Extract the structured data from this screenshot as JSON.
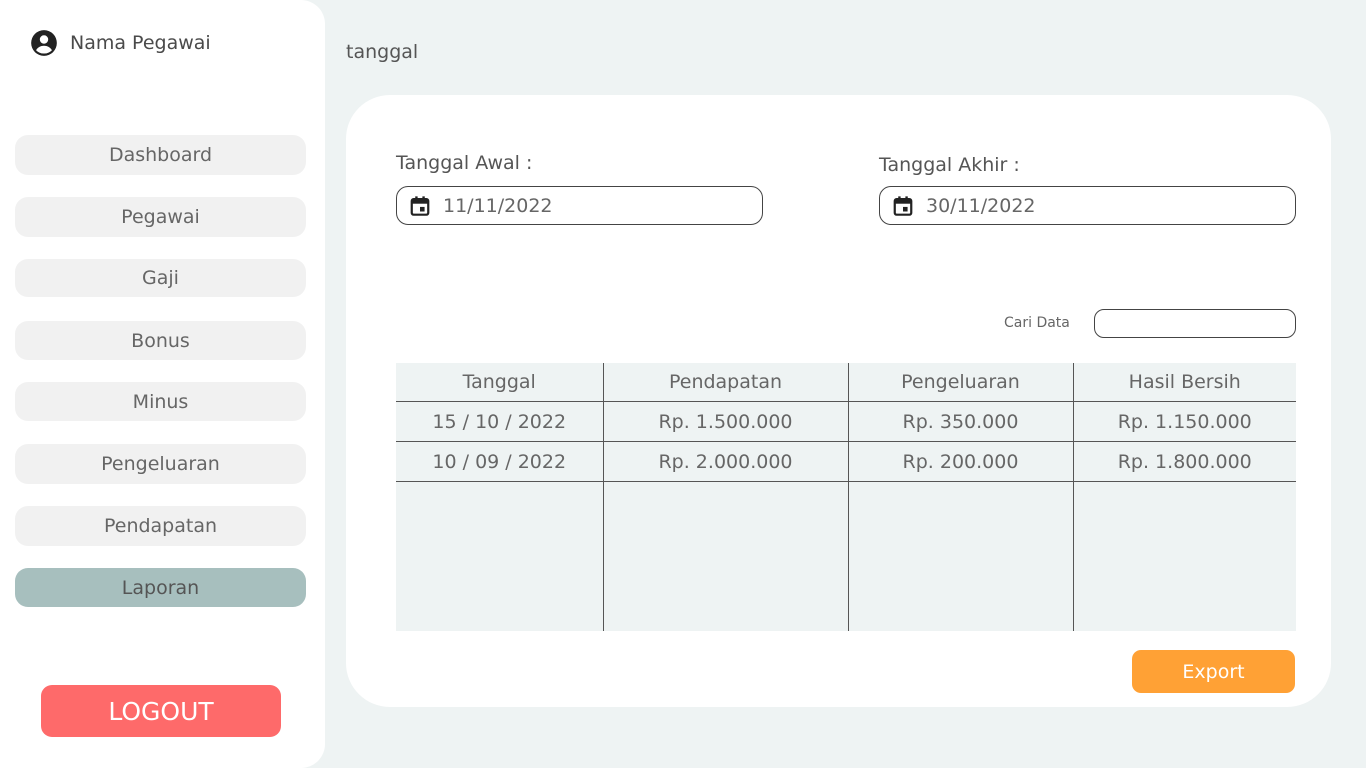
{
  "user": {
    "name": "Nama Pegawai",
    "icon": "account-circle-icon"
  },
  "sidebar": {
    "items": [
      {
        "label": "Dashboard"
      },
      {
        "label": "Pegawai"
      },
      {
        "label": "Gaji"
      },
      {
        "label": "Bonus"
      },
      {
        "label": "Minus"
      },
      {
        "label": "Pengeluaran"
      },
      {
        "label": "Pendapatan"
      },
      {
        "label": "Laporan",
        "active": true
      }
    ],
    "logout_label": "LOGOUT"
  },
  "page": {
    "title": "tanggal"
  },
  "filters": {
    "start_label": "Tanggal Awal :",
    "start_value": "11/11/2022",
    "end_label": "Tanggal Akhir :",
    "end_value": "30/11/2022",
    "search_label": "Cari Data",
    "search_value": ""
  },
  "table": {
    "headers": [
      "Tanggal",
      "Pendapatan",
      "Pengeluaran",
      "Hasil Bersih"
    ],
    "rows": [
      [
        "15 / 10 / 2022",
        "Rp. 1.500.000",
        "Rp. 350.000",
        "Rp. 1.150.000"
      ],
      [
        "10 / 09 / 2022",
        "Rp. 2.000.000",
        "Rp. 200.000",
        "Rp. 1.800.000"
      ]
    ]
  },
  "export_label": "Export",
  "colors": {
    "background": "#eef3f3",
    "active_nav": "#a7bfbe",
    "logout": "#fe6a6a",
    "export": "#ffa135"
  }
}
